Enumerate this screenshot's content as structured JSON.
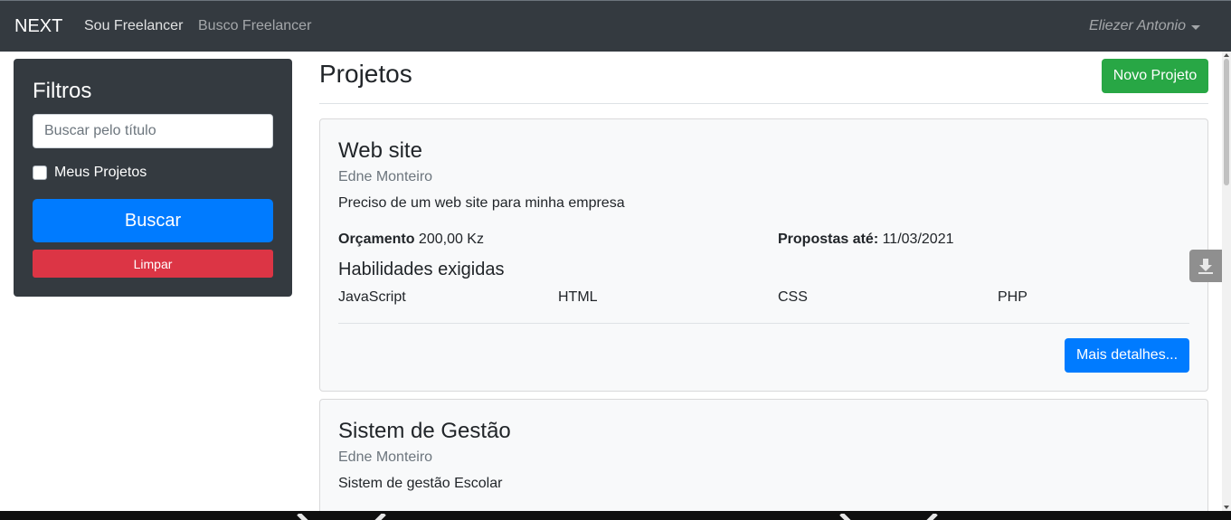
{
  "navbar": {
    "brand": "NEXT",
    "links": [
      "Sou Freelancer",
      "Busco Freelancer"
    ],
    "user": "Eliezer Antonio"
  },
  "sidebar": {
    "title": "Filtros",
    "search_placeholder": "Buscar pelo título",
    "checkbox_label": "Meus Projetos",
    "search_button": "Buscar",
    "clear_button": "Limpar"
  },
  "main": {
    "title": "Projetos",
    "new_project_button": "Novo Projeto",
    "projects": [
      {
        "title": "Web site",
        "author": "Edne Monteiro",
        "description": "Preciso de um web site para minha empresa",
        "budget_label": "Orçamento",
        "budget_value": "200,00 Kz",
        "deadline_label": "Propostas até:",
        "deadline_value": "11/03/2021",
        "skills_title": "Habilidades exigidas",
        "skills": [
          "JavaScript",
          "HTML",
          "CSS",
          "PHP"
        ],
        "details_button": "Mais detalhes..."
      },
      {
        "title": "Sistem de Gestão",
        "author": "Edne Monteiro",
        "description": "Sistem de gestão Escolar"
      }
    ]
  },
  "icons": {
    "download_widget": "download-icon"
  }
}
